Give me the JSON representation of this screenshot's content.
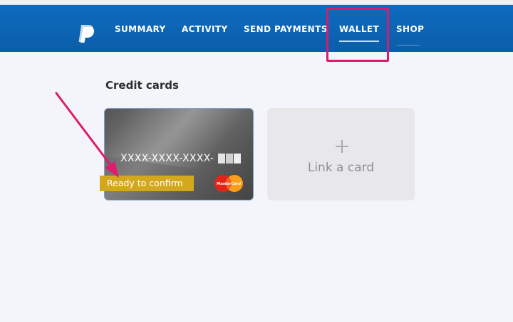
{
  "nav": {
    "items": [
      {
        "label": "SUMMARY"
      },
      {
        "label": "ACTIVITY"
      },
      {
        "label": "SEND PAYMENTS"
      },
      {
        "label": "WALLET"
      },
      {
        "label": "SHOP"
      }
    ],
    "active": "WALLET"
  },
  "section": {
    "title": "Credit cards"
  },
  "card": {
    "number": "XXXX-XXXX-XXXX-",
    "status_badge": "Ready to confirm",
    "network_logo": "mastercard-icon",
    "logo_text": "MasterCard"
  },
  "link_card": {
    "label": "Link a card",
    "icon": "plus-icon"
  },
  "colors": {
    "nav_bg": "#0b5ea9",
    "highlight": "#d81b6a",
    "badge": "#d4a81c",
    "page_bg": "#f4f5fa"
  }
}
